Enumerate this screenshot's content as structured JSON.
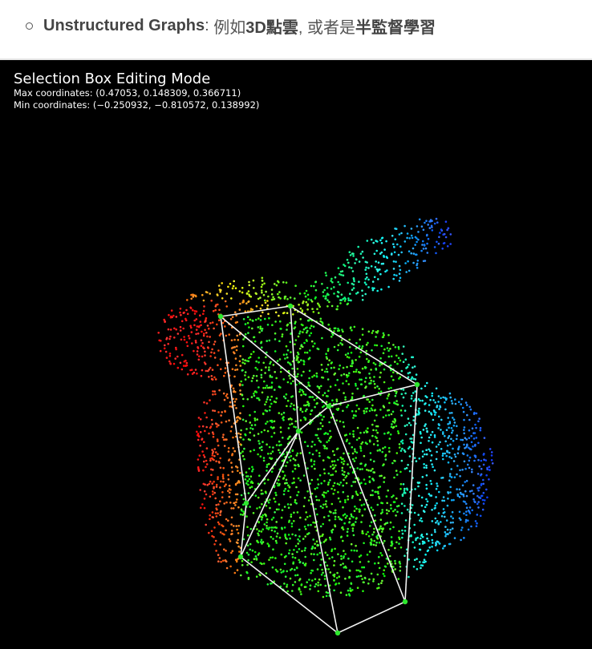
{
  "bullet": {
    "term": "Unstructured Graphs",
    "colon": ": ",
    "text1": "例如",
    "bold1": "3D點雲",
    "text2": ", 或者是",
    "bold2": "半監督學習"
  },
  "viewer": {
    "mode_title": "Selection Box Editing Mode",
    "max_coords": "Max coordinates: (0.47053, 0.148309, 0.366711)",
    "min_coords": "Min coordinates: (−0.250932, −0.810572, 0.138992)"
  },
  "colors": {
    "background": "#000000",
    "box_edge": "#f2f2f2",
    "box_vertex": "#2ee82e"
  }
}
